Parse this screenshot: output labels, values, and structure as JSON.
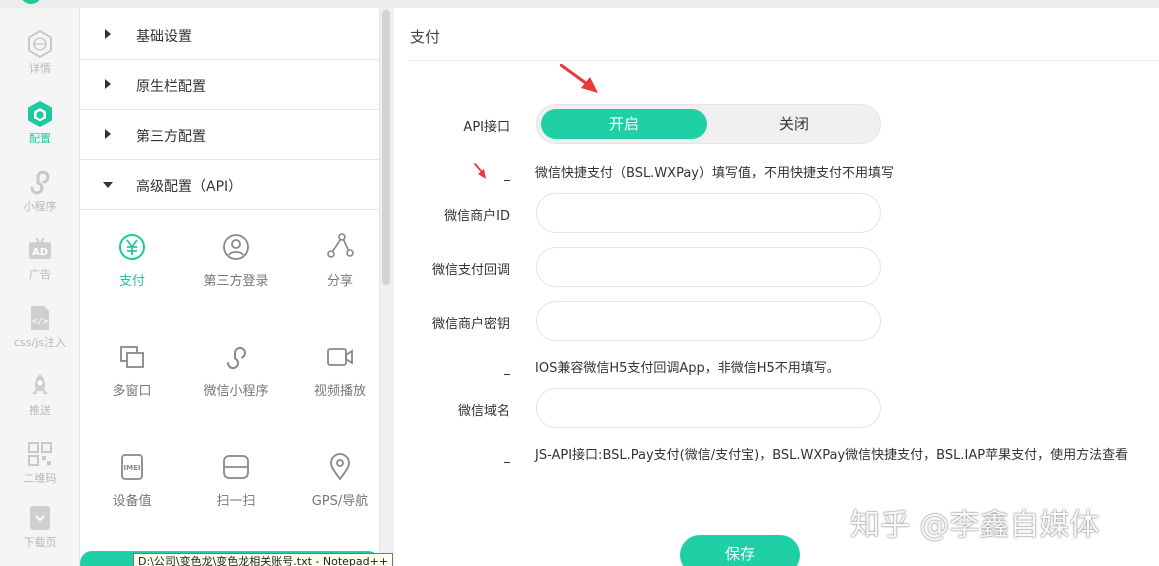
{
  "rail": {
    "items": [
      {
        "label": "详情",
        "icon": "web-icon"
      },
      {
        "label": "配置",
        "icon": "cube-icon"
      },
      {
        "label": "小程序",
        "icon": "mini-program-icon"
      },
      {
        "label": "广告",
        "icon": "ad-icon"
      },
      {
        "label": "css/js注入",
        "icon": "code-file-icon"
      },
      {
        "label": "推送",
        "icon": "rocket-icon"
      },
      {
        "label": "二维码",
        "icon": "qrcode-icon"
      },
      {
        "label": "下载页",
        "icon": "download-page-icon"
      }
    ],
    "active": "配置"
  },
  "config_menu": {
    "sections": [
      {
        "label": "基础设置",
        "expanded": false
      },
      {
        "label": "原生栏配置",
        "expanded": false
      },
      {
        "label": "第三方配置",
        "expanded": false
      },
      {
        "label": "高级配置（API）",
        "expanded": true
      }
    ],
    "api_items": [
      {
        "label": "支付",
        "icon": "yuan-icon"
      },
      {
        "label": "第三方登录",
        "icon": "user-icon"
      },
      {
        "label": "分享",
        "icon": "share-icon"
      },
      {
        "label": "多窗口",
        "icon": "multi-window-icon"
      },
      {
        "label": "微信小程序",
        "icon": "mini-program-icon"
      },
      {
        "label": "视频播放",
        "icon": "video-icon"
      },
      {
        "label": "设备值",
        "icon": "imei-icon"
      },
      {
        "label": "扫一扫",
        "icon": "scan-icon"
      },
      {
        "label": "GPS/导航",
        "icon": "location-icon"
      }
    ],
    "active": "支付"
  },
  "payment": {
    "title": "支付",
    "api_label": "API接口",
    "toggle_on": "开启",
    "toggle_off": "关闭",
    "wx_note": "微信快捷支付（BSL.WXPay）填写值，不用快捷支付不用填写",
    "fields": {
      "merchant_id_label": "微信商户ID",
      "callback_label": "微信支付回调",
      "merchant_key_label": "微信商户密钥",
      "domain_label": "微信域名"
    },
    "ios_note": "IOS兼容微信H5支付回调App，非微信H5不用填写。",
    "jsapi_note": "JS-API接口:BSL.Pay支付(微信/支付宝)，BSL.WXPay微信快捷支付，BSL.IAP苹果支付，使用方法查看",
    "save_label": "保存"
  },
  "watermark": "知乎 @李鑫自媒体",
  "taskbar_tooltip": "D:\\公司\\变色龙\\变色龙相关账号.txt - Notepad++",
  "colors": {
    "accent": "#1fd0a6",
    "arrow": "#e8393b"
  }
}
